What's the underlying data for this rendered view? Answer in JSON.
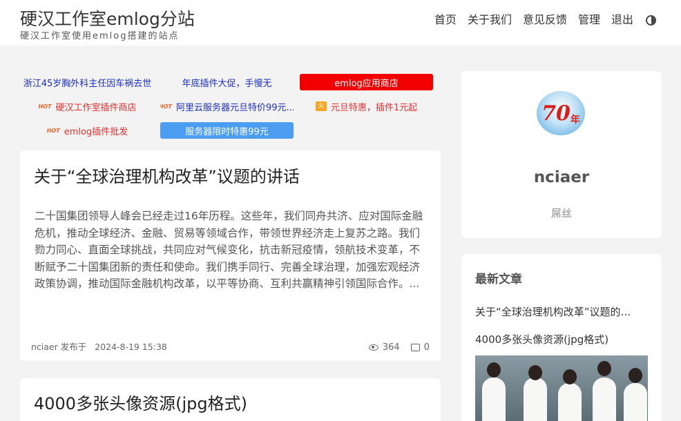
{
  "header": {
    "title": "硬汉工作室emlog分站",
    "subtitle": "硬汉工作室使用emlog搭建的站点",
    "nav": [
      "首页",
      "关于我们",
      "意见反馈",
      "管理",
      "退出"
    ],
    "theme_icon": "half-circle-icon"
  },
  "ads": {
    "row1": [
      "浙江45岁胸外科主任因车祸去世",
      "年底插件大促，手慢无",
      "emlog应用商店"
    ],
    "row2": [
      "硬汉工作室插件商店",
      "阿里云服务器元旦特价99元...",
      "元旦特惠，插件1元起"
    ],
    "row3": [
      "emlog插件批发",
      "服务器限时特惠99元"
    ],
    "hot_badge": "HOT",
    "fire_badge": "火",
    "colors": {
      "red": "#f20000",
      "blue": "#4a9df0",
      "link_blue": "#1a2fbf",
      "link_red": "#e23131"
    }
  },
  "posts": [
    {
      "title": "关于“全球治理机构改革”议题的讲话",
      "excerpt": "二十国集团领导人峰会已经走过16年历程。这些年，我们同舟共济、应对国际金融危机，推动全球经济、金融、贸易等领域合作，带领世界经济走上复苏之路。我们勠力同心、直面全球挑战，共同应对气候变化，抗击新冠疫情，领航技术变革，不断赋予二十国集团新的责任和使命。我们携手同行、完善全球治理，加强宏观经济政策协调，推动国际金融机构改革，以平等协商、互利共赢精神引领国际合作。...",
      "author": "nciaer",
      "published_label": "发布于",
      "date": "2024-8-19 15:38",
      "views": "364",
      "comments": "0"
    },
    {
      "title": "4000多张头像资源(jpg格式)"
    }
  ],
  "profile": {
    "name": "nciaer",
    "description": "屌丝",
    "avatar_text": "70",
    "avatar_suffix": "年"
  },
  "latest": {
    "heading": "最新文章",
    "items": [
      "关于“全球治理机构改革”议题的讲话",
      "4000多张头像资源(jpg格式)"
    ]
  }
}
